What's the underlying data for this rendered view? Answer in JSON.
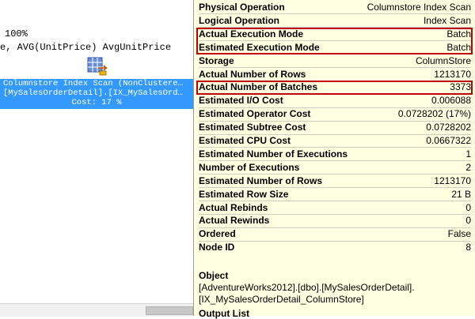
{
  "plan": {
    "top_line": "100%",
    "code_line": "e, AVG(UnitPrice) AvgUnitPrice",
    "node": {
      "icon": "columnstore-index-scan-icon",
      "line1": "Columnstore Index Scan (NonClustere…",
      "line2": "[MySalesOrderDetail].[IX_MySalesOrd…",
      "line3": "Cost: 17 %"
    }
  },
  "tooltip": {
    "properties": [
      {
        "label": "Physical Operation",
        "value": "Columnstore Index Scan"
      },
      {
        "label": "Logical Operation",
        "value": "Index Scan"
      },
      {
        "label": "Actual Execution Mode",
        "value": "Batch"
      },
      {
        "label": "Estimated Execution Mode",
        "value": "Batch"
      },
      {
        "label": "Storage",
        "value": "ColumnStore"
      },
      {
        "label": "Actual Number of Rows",
        "value": "1213170"
      },
      {
        "label": "Actual Number of Batches",
        "value": "3373"
      },
      {
        "label": "Estimated I/O Cost",
        "value": "0.006088"
      },
      {
        "label": "Estimated Operator Cost",
        "value": "0.0728202 (17%)"
      },
      {
        "label": "Estimated Subtree Cost",
        "value": "0.0728202"
      },
      {
        "label": "Estimated CPU Cost",
        "value": "0.0667322"
      },
      {
        "label": "Estimated Number of Executions",
        "value": "1"
      },
      {
        "label": "Number of Executions",
        "value": "2"
      },
      {
        "label": "Estimated Number of Rows",
        "value": "1213170"
      },
      {
        "label": "Estimated Row Size",
        "value": "21 B"
      },
      {
        "label": "Actual Rebinds",
        "value": "0"
      },
      {
        "label": "Actual Rewinds",
        "value": "0"
      },
      {
        "label": "Ordered",
        "value": "False"
      },
      {
        "label": "Node ID",
        "value": "8"
      }
    ],
    "object_title": "Object",
    "object_line1": "[AdventureWorks2012].[dbo].[MySalesOrderDetail].",
    "object_line2": "[IX_MySalesOrderDetail_ColumnStore]",
    "output_title": "Output List"
  },
  "colors": {
    "tooltip_bg": "#ffffe1",
    "highlight_border": "#c00000",
    "selected_node_bg": "#3399ff"
  }
}
